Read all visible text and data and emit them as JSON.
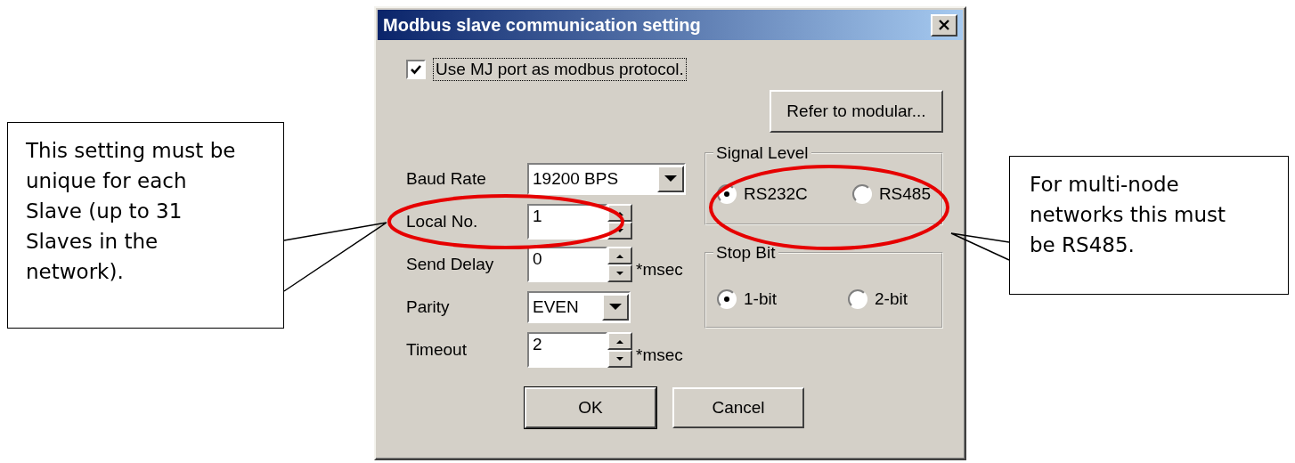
{
  "dialog": {
    "title": "Modbus slave communication setting",
    "use_mj_port": {
      "label": "Use MJ port as modbus protocol.",
      "checked": true
    },
    "refer_button": "Refer to modular...",
    "fields": [
      {
        "kind": "combo",
        "label": "Baud Rate",
        "value": "19200 BPS"
      },
      {
        "kind": "spin",
        "label": "Local No.",
        "value": "1"
      },
      {
        "kind": "spin",
        "label": "Send Delay",
        "value": "0",
        "unit": "*msec"
      },
      {
        "kind": "combo",
        "label": "Parity",
        "value": "EVEN"
      },
      {
        "kind": "spin",
        "label": "Timeout",
        "value": "2",
        "unit": "*msec"
      }
    ],
    "signal_level": {
      "title": "Signal Level",
      "options": [
        {
          "label": "RS232C",
          "selected": true
        },
        {
          "label": "RS485",
          "selected": false
        }
      ]
    },
    "stop_bit": {
      "title": "Stop Bit",
      "options": [
        {
          "label": "1-bit",
          "selected": true
        },
        {
          "label": "2-bit",
          "selected": false
        }
      ]
    },
    "buttons": [
      {
        "label": "OK",
        "default": true
      },
      {
        "label": "Cancel",
        "default": false
      }
    ]
  },
  "callouts": [
    {
      "text": "This setting must be unique for each Slave (up to 31 Slaves in the network)."
    },
    {
      "text": "For multi-node networks this must be RS485."
    }
  ]
}
